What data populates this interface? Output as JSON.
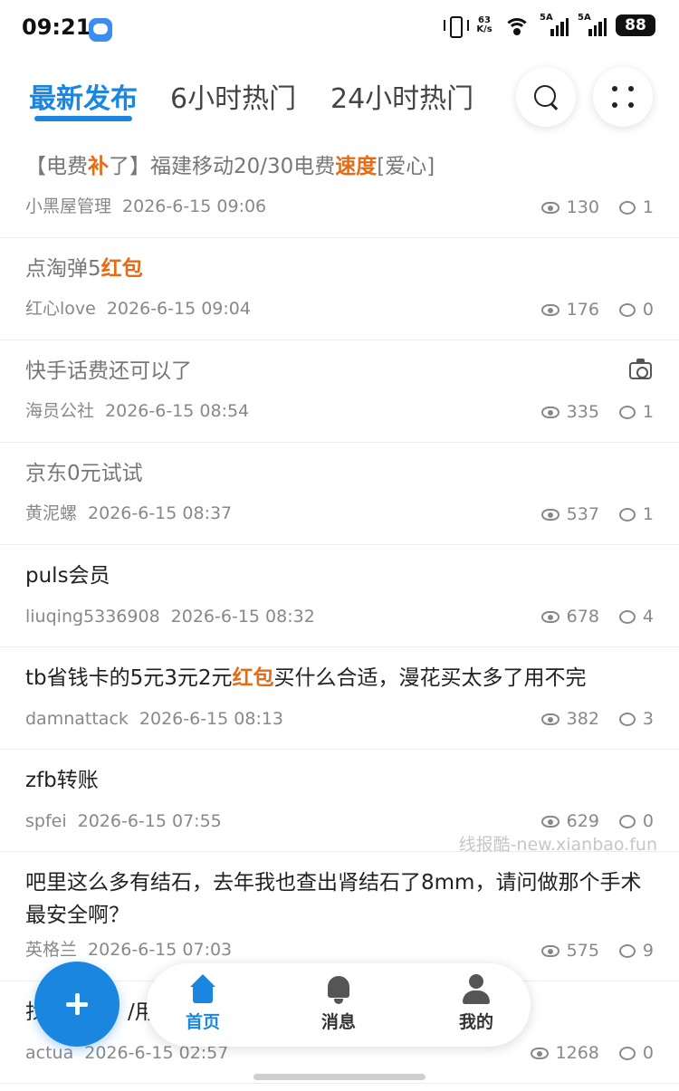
{
  "status_bar": {
    "time": "09:21",
    "net_speed_value": "63",
    "net_speed_unit": "K/s",
    "signal_1_label": "5A",
    "signal_2_label": "5A",
    "battery": "88"
  },
  "header": {
    "tabs": [
      {
        "label": "最新发布",
        "active": true
      },
      {
        "label": "6小时热门",
        "active": false
      },
      {
        "label": "24小时热门",
        "active": false
      }
    ],
    "accent_color": "#1a86e0"
  },
  "posts": [
    {
      "title_parts": [
        "【电费",
        "补",
        "了】福建移动20/30电费",
        "速度",
        "[爱心]"
      ],
      "author": "小黑屋管理",
      "time": "2026-6-15 09:06",
      "views": "130",
      "comments": "1",
      "read": true
    },
    {
      "title_parts": [
        "点淘弹5",
        "红包"
      ],
      "author": "红心love",
      "time": "2026-6-15 09:04",
      "views": "176",
      "comments": "0",
      "read": true
    },
    {
      "title": "快手话费还可以了",
      "author": "海员公社",
      "time": "2026-6-15 08:54",
      "views": "335",
      "comments": "1",
      "read": true,
      "has_image": true,
      "image_icon": "camera-icon"
    },
    {
      "title": "京东0元试试",
      "author": "黄泥螺",
      "time": "2026-6-15 08:37",
      "views": "537",
      "comments": "1",
      "read": true
    },
    {
      "title": "puls会员",
      "author": "liuqing5336908",
      "time": "2026-6-15 08:32",
      "views": "678",
      "comments": "4",
      "read": false
    },
    {
      "title_parts": [
        "tb省钱卡的5元3元2元",
        "红包",
        "买什么合适，漫花买太多了用不完"
      ],
      "author": "damnattack",
      "time": "2026-6-15 08:13",
      "views": "382",
      "comments": "3",
      "read": false
    },
    {
      "title": "zfb转账",
      "author": "spfei",
      "time": "2026-6-15 07:55",
      "views": "629",
      "comments": "0",
      "read": false
    },
    {
      "title": "吧里这么多有结石，去年我也查出肾结石了8mm，请问做那个手术最安全啊？",
      "author": "英格兰",
      "time": "2026-6-15 07:03",
      "views": "575",
      "comments": "9",
      "read": false
    },
    {
      "title_parts": [
        "找",
        "/用"
      ],
      "author": "actua",
      "time": "2026-6-15 02:57",
      "views": "1268",
      "comments": "0",
      "read": false
    }
  ],
  "watermark": "线报酷-new.xianbao.fun",
  "bottom_nav": {
    "items": [
      {
        "label": "首页",
        "icon": "home-icon",
        "active": true
      },
      {
        "label": "消息",
        "icon": "bell-icon",
        "active": false
      },
      {
        "label": "我的",
        "icon": "user-icon",
        "active": false
      }
    ]
  },
  "highlight_color": "#e66b15"
}
